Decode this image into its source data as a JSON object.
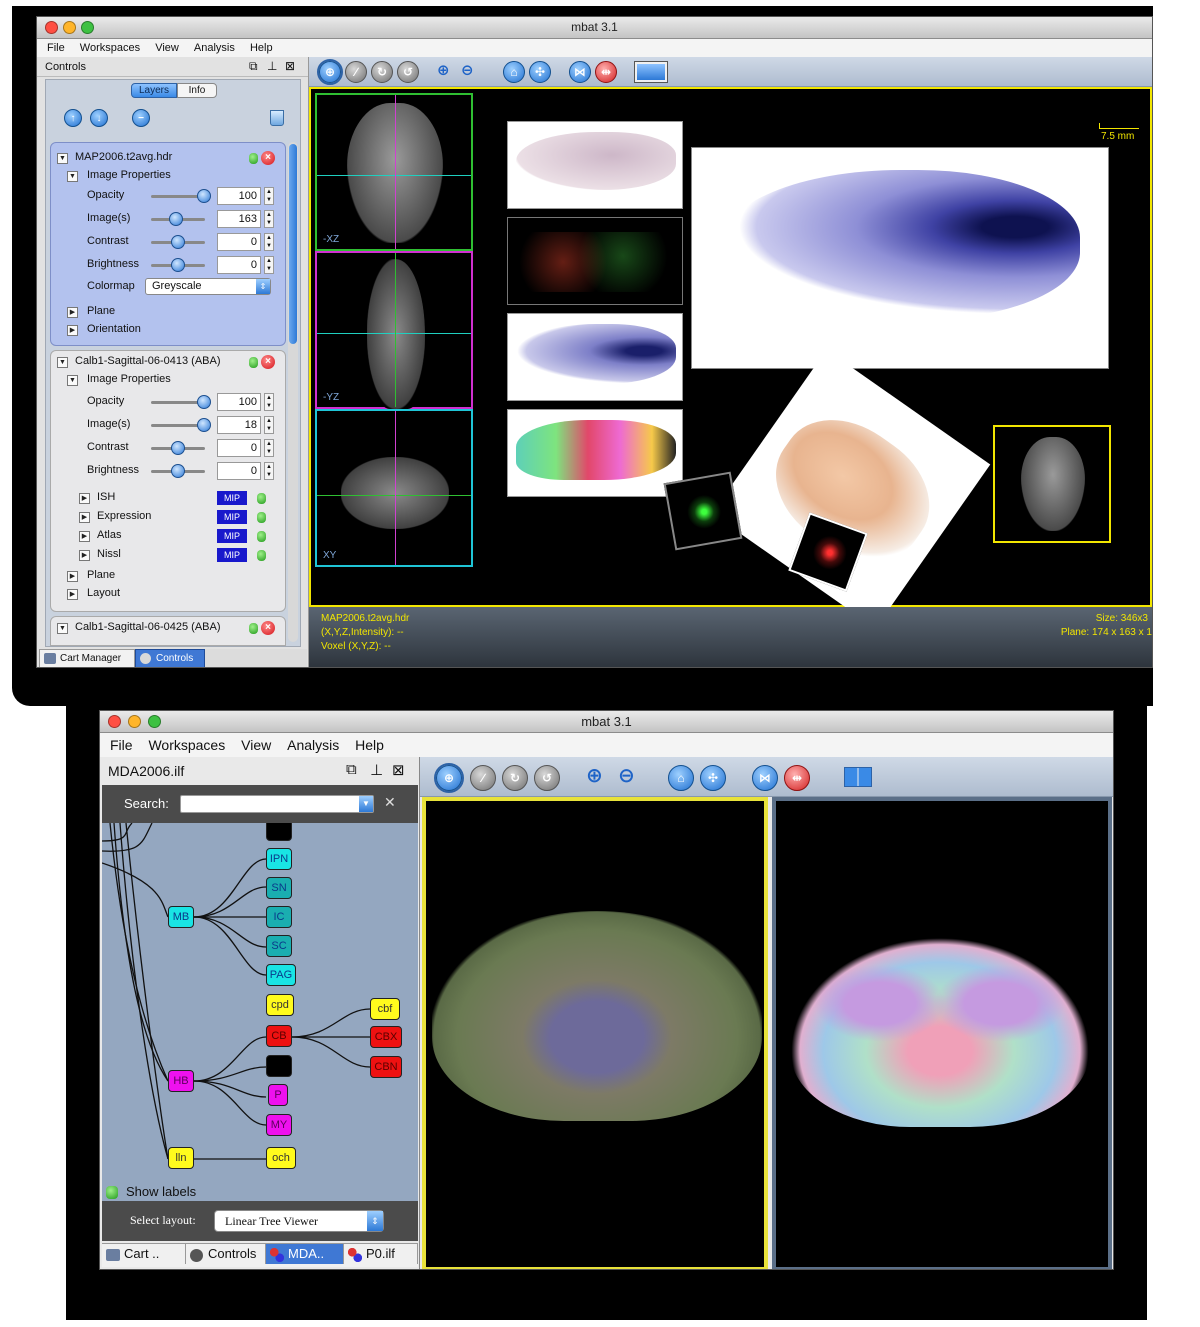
{
  "window1": {
    "title": "mbat 3.1",
    "menu": [
      "File",
      "Workspaces",
      "View",
      "Analysis",
      "Help"
    ],
    "panel_title": "Controls",
    "tabs": [
      "Layers",
      "Info"
    ],
    "layers": [
      {
        "name": "MAP2006.t2avg.hdr",
        "section": "Image Properties",
        "props": [
          {
            "label": "Opacity",
            "value": "100"
          },
          {
            "label": "Image(s)",
            "value": "163"
          },
          {
            "label": "Contrast",
            "value": "0"
          },
          {
            "label": "Brightness",
            "value": "0"
          }
        ],
        "colormap_label": "Colormap",
        "colormap_value": "Greyscale",
        "extra": [
          "Plane",
          "Orientation"
        ]
      },
      {
        "name": "Calb1-Sagittal-06-0413 (ABA)",
        "section": "Image Properties",
        "props": [
          {
            "label": "Opacity",
            "value": "100"
          },
          {
            "label": "Image(s)",
            "value": "18"
          },
          {
            "label": "Contrast",
            "value": "0"
          },
          {
            "label": "Brightness",
            "value": "0"
          }
        ],
        "channels": [
          {
            "label": "ISH",
            "badge": "MIP"
          },
          {
            "label": "Expression",
            "badge": "MIP"
          },
          {
            "label": "Atlas",
            "badge": "MIP"
          },
          {
            "label": "Nissl",
            "badge": "MIP"
          }
        ],
        "extra": [
          "Plane",
          "Layout"
        ]
      },
      {
        "name": "Calb1-Sagittal-06-0425 (ABA)"
      }
    ],
    "bottom_tabs": [
      "Cart Manager",
      "Controls"
    ],
    "view_labels": [
      "-XZ",
      "-YZ",
      "XY"
    ],
    "scale_bar": "7.5 mm",
    "status": {
      "file": "MAP2006.t2avg.hdr",
      "intensity": "(X,Y,Z,Intensity): --",
      "voxel": "Voxel (X,Y,Z): --",
      "size": "Size: 346x3",
      "plane": "Plane: 174 x 163 x 1"
    }
  },
  "window2": {
    "title": "mbat 3.1",
    "menu": [
      "File",
      "Workspaces",
      "View",
      "Analysis",
      "Help"
    ],
    "panel_title": "MDA2006.ilf",
    "search_label": "Search:",
    "search_value": "",
    "tree_nodes": [
      "IPN",
      "SN",
      "IC",
      "SC",
      "MB",
      "PAG",
      "cpd",
      "CB",
      "HB",
      "P",
      "MY",
      "lln",
      "och",
      "cbf",
      "CBX",
      "CBN"
    ],
    "show_labels": "Show labels",
    "select_layout_label": "Select layout:",
    "select_layout_value": "Linear Tree Viewer",
    "bottom_tabs": [
      "Cart ..",
      "Controls",
      "MDA..",
      "P0.ilf"
    ]
  },
  "colors": {
    "accent_yellow": "#f2e600",
    "cyan_node": "#19e4e4",
    "teal_node": "#1aaeb0",
    "red_node": "#ee1111",
    "magenta_node": "#ee11ee",
    "mip_blue": "#1818cc"
  },
  "icons": [
    "crosshair-icon",
    "slice-icon",
    "rotate-icon",
    "reset-rotate-icon",
    "zoom-in-icon",
    "zoom-out-icon",
    "home-icon",
    "fit-icon",
    "link-icon",
    "unlink-icon",
    "layout-icon",
    "arrow-up-icon",
    "arrow-down-icon",
    "remove-icon",
    "trash-icon"
  ]
}
